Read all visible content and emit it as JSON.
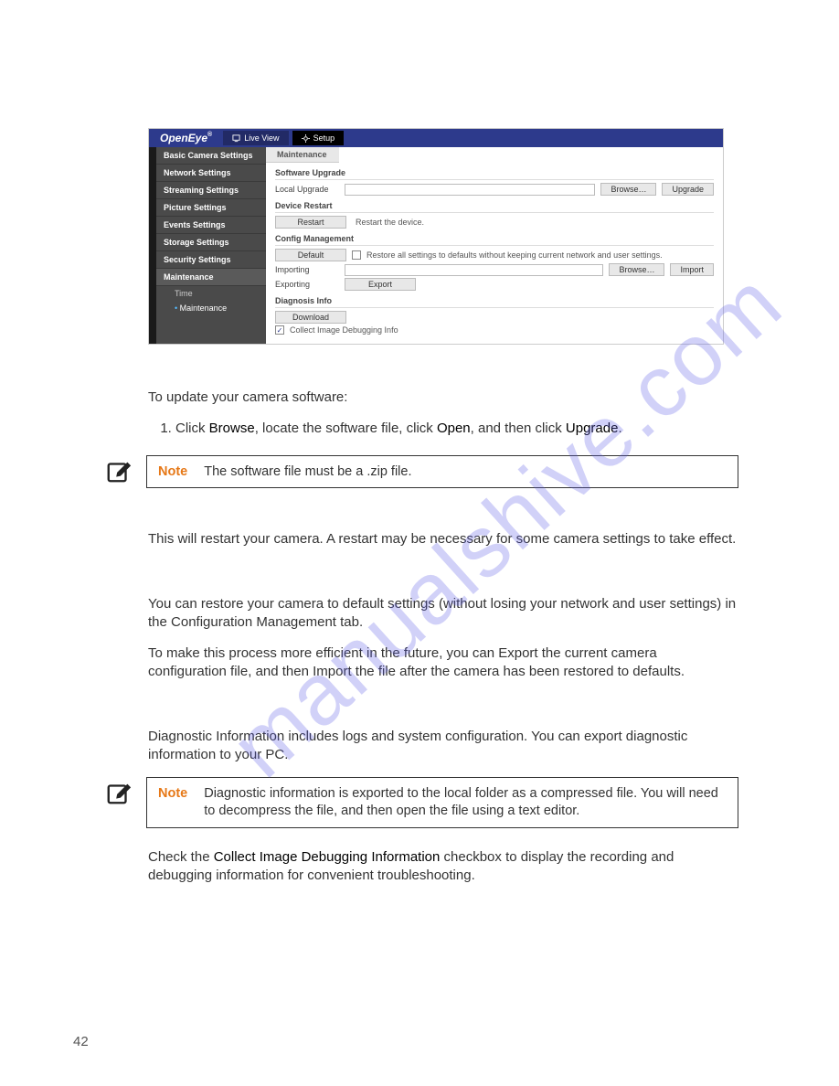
{
  "app": {
    "brand": "OpenEye",
    "header_buttons": [
      {
        "label": "Live View",
        "icon": "monitor-icon"
      },
      {
        "label": "Setup",
        "icon": "gear-icon"
      }
    ],
    "sidebar": [
      "Basic Camera Settings",
      "Network Settings",
      "Streaming Settings",
      "Picture Settings",
      "Events Settings",
      "Storage Settings",
      "Security Settings",
      "Maintenance"
    ],
    "sidebar_sub": [
      {
        "label": "Time",
        "selected": false
      },
      {
        "label": "Maintenance",
        "selected": true
      }
    ],
    "main_tab": "Maintenance",
    "sections": {
      "software_upgrade": {
        "title": "Software Upgrade",
        "local_upgrade_label": "Local Upgrade",
        "browse": "Browse…",
        "upgrade": "Upgrade"
      },
      "device_restart": {
        "title": "Device Restart",
        "restart": "Restart",
        "desc": "Restart the device."
      },
      "config_mgmt": {
        "title": "Config Management",
        "default": "Default",
        "restore_hint": "Restore all settings to defaults without keeping current network and user settings.",
        "importing_label": "Importing",
        "browse": "Browse…",
        "import": "Import",
        "exporting_label": "Exporting",
        "export": "Export"
      },
      "diag": {
        "title": "Diagnosis Info",
        "download": "Download",
        "collect_label": "Collect Image Debugging Info",
        "checked": "✓"
      }
    }
  },
  "doc": {
    "intro": "To update your camera software:",
    "step1_a": "Click ",
    "step1_b": "Browse",
    "step1_c": ", locate the software file, click ",
    "step1_d": "Open",
    "step1_e": ", and then click ",
    "step1_f": "Upgrade",
    "step1_g": ".",
    "note1_label": "Note",
    "note1_body": "The software file must be a .zip file.",
    "restart_para": "This will restart your camera. A restart may be necessary for some camera settings to take effect.",
    "restore_para": "You can restore your camera to default settings (without losing your network and user settings) in the Configuration Management tab.",
    "export_para": "To make this process more efficient in the future, you can Export the current camera configuration file, and then Import the file after the camera has been restored to defaults.",
    "diag_para": "Diagnostic Information includes logs and system configuration. You can export diagnostic information to your PC.",
    "note2_label": "Note",
    "note2_body": "Diagnostic information is exported to the local folder as a compressed file. You will need to decompress the file, and then open the file using a text editor.",
    "check_a": "Check the ",
    "check_b": "Collect Image Debugging Information",
    "check_c": " checkbox to display the recording and debugging information for convenient troubleshooting.",
    "page_number": "42",
    "watermark": "manualshive.com"
  }
}
